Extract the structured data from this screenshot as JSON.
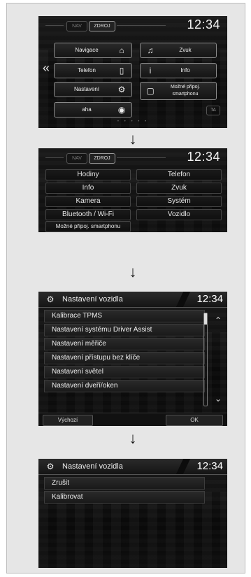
{
  "screen1": {
    "tabs": [
      "NAV",
      "ZDROJ"
    ],
    "time": "12:34",
    "buttons": {
      "navigace": "Navigace",
      "zvuk": "Zvuk",
      "telefon": "Telefon",
      "info": "Info",
      "nastaveni": "Nastavení",
      "smartphone": "Možné připoj. smartphonu",
      "aha": "aha"
    },
    "ta": "TA",
    "page_dots": 5,
    "active_dot": 5
  },
  "screen2": {
    "tabs": [
      "NAV",
      "ZDROJ"
    ],
    "time": "12:34",
    "grid": [
      [
        "Hodiny",
        "Telefon"
      ],
      [
        "Info",
        "Zvuk"
      ],
      [
        "Kamera",
        "Systém"
      ],
      [
        "Bluetooth / Wi-Fi",
        "Vozidlo"
      ]
    ],
    "extra": "Možné připoj. smartphonu"
  },
  "screen3": {
    "title": "Nastavení vozidla",
    "time": "12:34",
    "items": [
      "Kalibrace TPMS",
      "Nastavení systému Driver Assist",
      "Nastavení měřiče",
      "Nastavení přístupu bez klíče",
      "Nastavení světel",
      "Nastavení dveří/oken"
    ],
    "footer": {
      "default": "Výchozí",
      "ok": "OK"
    }
  },
  "screen4": {
    "title": "Nastavení vozidla",
    "time": "12:34",
    "items": [
      "Zrušit",
      "Kalibrovat"
    ]
  },
  "arrow_glyph": "➔"
}
